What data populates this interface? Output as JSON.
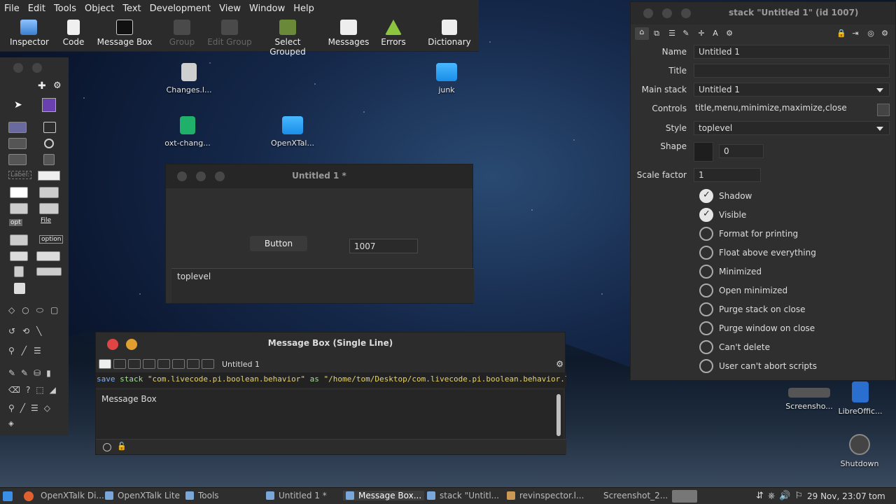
{
  "menubar": {
    "items": [
      "File",
      "Edit",
      "Tools",
      "Object",
      "Text",
      "Development",
      "View",
      "Window",
      "Help"
    ]
  },
  "toolbar": {
    "buttons": [
      {
        "label": "Inspector",
        "icon": "inspector-icon",
        "enabled": true
      },
      {
        "label": "Code",
        "icon": "code-icon",
        "enabled": true
      },
      {
        "label": "Message Box",
        "icon": "terminal-icon",
        "enabled": true
      },
      {
        "label": "Group",
        "icon": "group-icon",
        "enabled": false
      },
      {
        "label": "Edit Group",
        "icon": "edit-group-icon",
        "enabled": false
      },
      {
        "label": "Select Grouped",
        "icon": "select-grouped-icon",
        "enabled": true
      },
      {
        "label": "Messages",
        "icon": "envelope-icon",
        "enabled": true
      },
      {
        "label": "Errors",
        "icon": "warning-icon",
        "enabled": true
      },
      {
        "label": "Dictionary",
        "icon": "dictionary-icon",
        "enabled": true
      }
    ]
  },
  "tools_palette": {
    "label_tool": "Label:",
    "option_tool": "option",
    "file_tool": "File",
    "opt_tool": "opt"
  },
  "desktop": {
    "icons": [
      {
        "label": "Changes.l...",
        "icon": "file-icon"
      },
      {
        "label": "oxt-chang...",
        "icon": "app-icon"
      },
      {
        "label": "OpenXTal...",
        "icon": "folder-icon"
      },
      {
        "label": "junk",
        "icon": "folder-icon"
      },
      {
        "label": "Screensho...",
        "icon": "image-icon"
      },
      {
        "label": "LibreOffic...",
        "icon": "document-icon"
      },
      {
        "label": "Shutdown",
        "icon": "power-icon"
      }
    ]
  },
  "untitled_window": {
    "title": "Untitled 1 *",
    "button_label": "Button",
    "field_value": "1007",
    "text_value": "toplevel"
  },
  "message_box": {
    "title": "Message Box (Single Line)",
    "stack_selector": "Untitled 1",
    "command": {
      "kw": "save",
      "kw2": "stack",
      "arg1": "\"com.livecode.pi.boolean.behavior\"",
      "kw3": "as",
      "arg2": "\"/home/tom/Desktop/com.livecode.pi.boolean.behavior.livecodescript\""
    },
    "output": "Message Box"
  },
  "inspector": {
    "title": "stack \"Untitled 1\" (id 1007)",
    "fields": {
      "name_label": "Name",
      "name_value": "Untitled 1",
      "title_label": "Title",
      "title_value": "",
      "mainstack_label": "Main stack",
      "mainstack_value": "Untitled 1",
      "controls_label": "Controls",
      "controls_value": "title,menu,minimize,maximize,close",
      "style_label": "Style",
      "style_value": "toplevel",
      "shape_label": "Shape",
      "shape_value": "0",
      "scale_label": "Scale factor",
      "scale_value": "1"
    },
    "checkboxes": [
      {
        "label": "Shadow",
        "checked": true
      },
      {
        "label": "Visible",
        "checked": true
      },
      {
        "label": "Format for printing",
        "checked": false
      },
      {
        "label": "Float above everything",
        "checked": false
      },
      {
        "label": "Minimized",
        "checked": false
      },
      {
        "label": "Open minimized",
        "checked": false
      },
      {
        "label": "Purge stack on close",
        "checked": false
      },
      {
        "label": "Purge window on close",
        "checked": false
      },
      {
        "label": "Can't delete",
        "checked": false
      },
      {
        "label": "User can't abort scripts",
        "checked": false
      }
    ]
  },
  "taskbar": {
    "tasks": [
      {
        "label": "OpenXTalk Di...",
        "active": false
      },
      {
        "label": "OpenXTalk Lite",
        "active": false
      },
      {
        "label": "Tools",
        "active": false
      },
      {
        "label": "Untitled 1 *",
        "active": false
      },
      {
        "label": "Message Box...",
        "active": true
      },
      {
        "label": "stack \"Untitl...",
        "active": false
      },
      {
        "label": "revinspector.l...",
        "active": false
      },
      {
        "label": "Screenshot_2...",
        "active": false
      }
    ],
    "clock": "29 Nov, 23:07",
    "user": "tom"
  },
  "colors": {
    "accent": "#7fb0ff",
    "string": "#e6d36a",
    "close_red": "#e04444",
    "min_yellow": "#e0a030"
  }
}
